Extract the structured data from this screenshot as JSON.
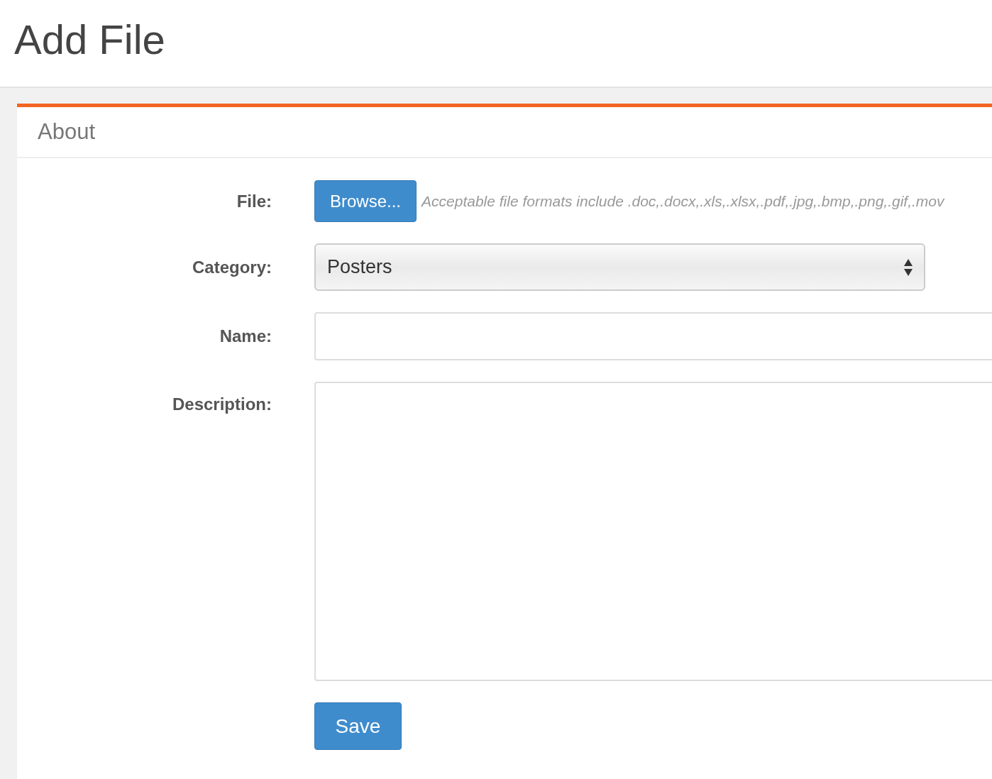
{
  "page_title": "Add File",
  "panel": {
    "title": "About"
  },
  "form": {
    "fields": [
      {
        "kind": "file",
        "label": "File:",
        "button": "Browse...",
        "help": "Acceptable file formats include .doc,.docx,.xls,.xlsx,.pdf,.jpg,.bmp,.png,.gif,.mov"
      },
      {
        "kind": "select",
        "label": "Category:",
        "value": "Posters"
      },
      {
        "kind": "text",
        "label": "Name:"
      },
      {
        "kind": "textarea",
        "label": "Description:"
      }
    ],
    "submit": "Save"
  }
}
